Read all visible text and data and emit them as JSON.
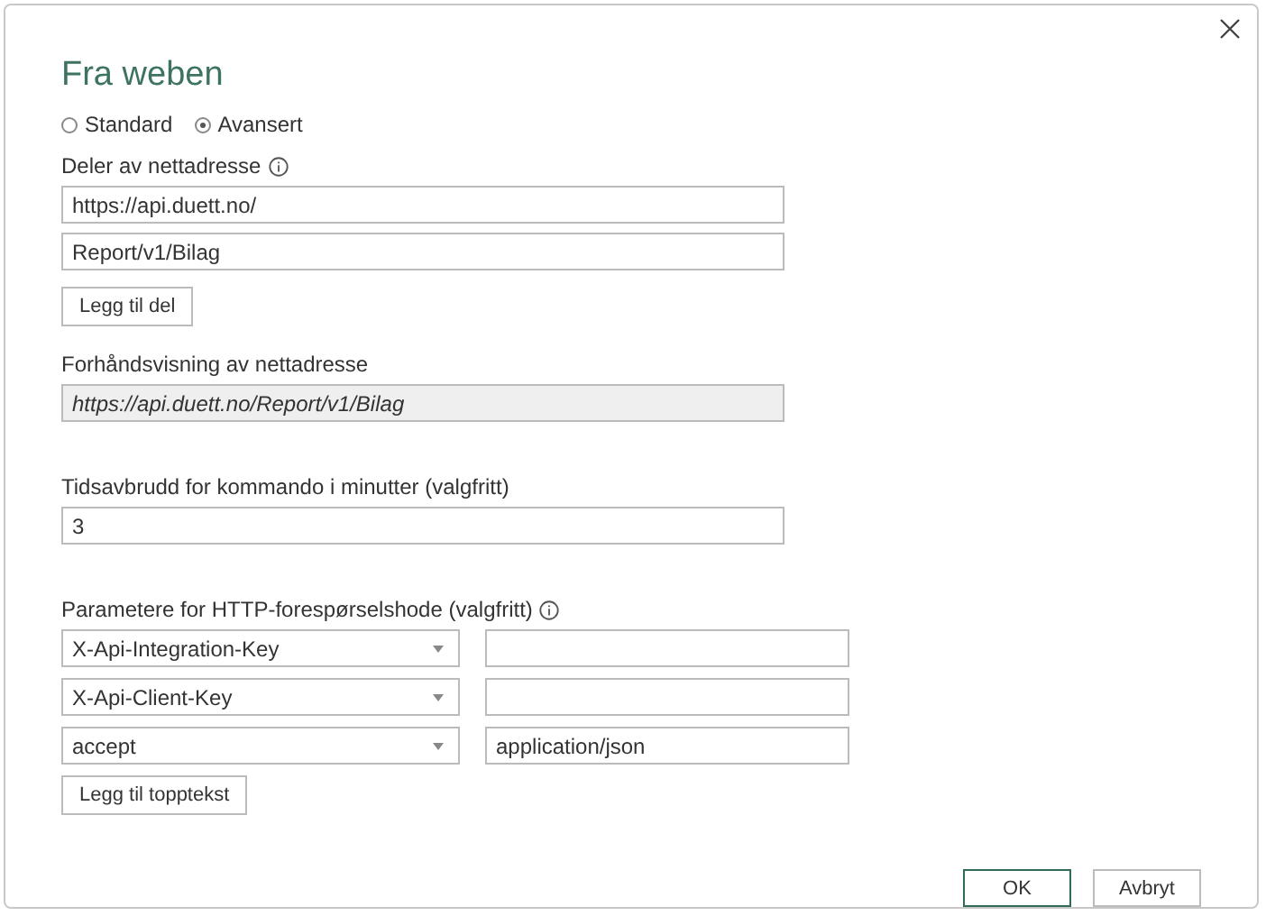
{
  "window": {
    "title": "Fra weben"
  },
  "modes": [
    {
      "label": "Standard",
      "selected": false
    },
    {
      "label": "Avansert",
      "selected": true
    }
  ],
  "url_parts": {
    "label": "Deler av nettadresse",
    "values": [
      "https://api.duett.no/",
      "Report/v1/Bilag"
    ],
    "add_button": "Legg til del"
  },
  "preview": {
    "label": "Forhåndsvisning av nettadresse",
    "value": "https://api.duett.no/Report/v1/Bilag"
  },
  "timeout": {
    "label": "Tidsavbrudd for kommando i minutter (valgfritt)",
    "value": "3"
  },
  "headers": {
    "label": "Parametere for HTTP-forespørselshode (valgfritt)",
    "rows": [
      {
        "name": "X-Api-Integration-Key",
        "value": ""
      },
      {
        "name": "X-Api-Client-Key",
        "value": ""
      },
      {
        "name": "accept",
        "value": "application/json"
      }
    ],
    "add_button": "Legg til topptekst"
  },
  "buttons": [
    "OK",
    "Avbryt"
  ]
}
